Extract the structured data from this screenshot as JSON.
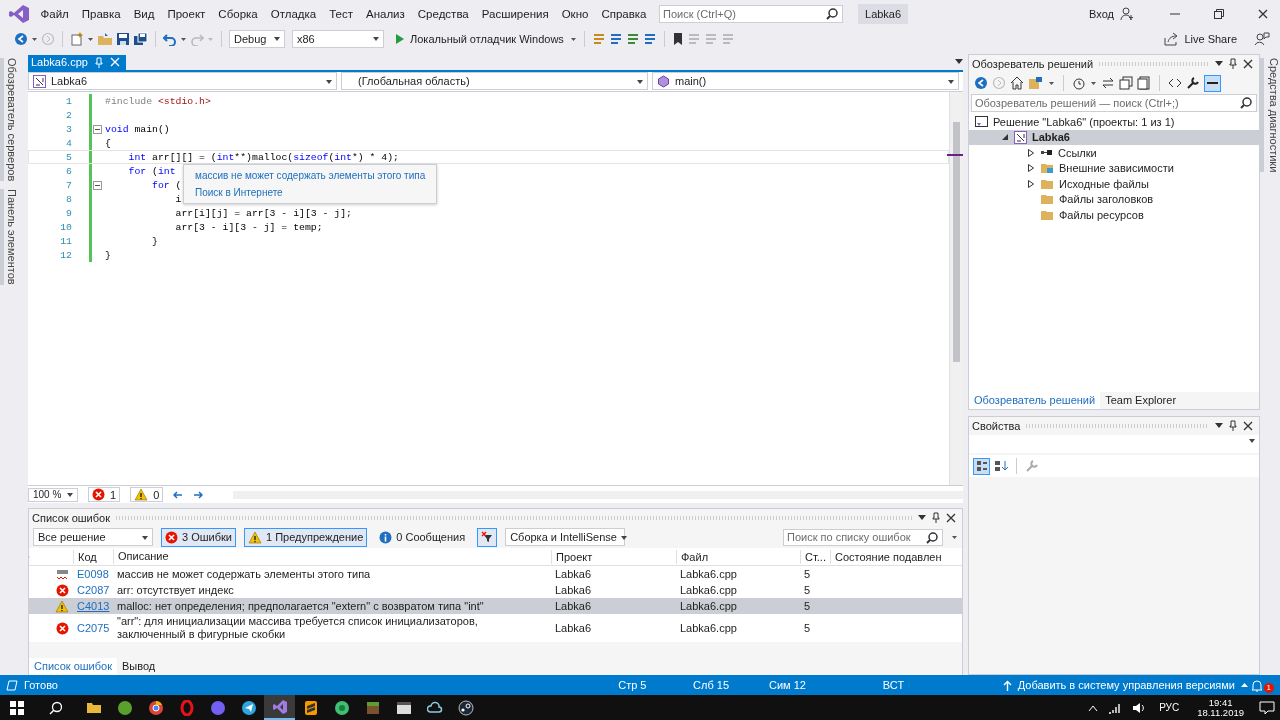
{
  "title_bar": {
    "menu": [
      "Файл",
      "Правка",
      "Вид",
      "Проект",
      "Сборка",
      "Отладка",
      "Тест",
      "Анализ",
      "Средства",
      "Расширения",
      "Окно",
      "Справка"
    ],
    "search": {
      "placeholder": "Поиск (Ctrl+Q)"
    },
    "solution_name": "Labka6",
    "sign_in": "Вход"
  },
  "toolbar": {
    "configuration": "Debug",
    "platform": "x86",
    "run": "Локальный отладчик Windows",
    "live_share": "Live Share"
  },
  "left_tabs": [
    "Обозреватель серверов",
    "Панель элементов"
  ],
  "right_tabs": [
    "Средства диагностики"
  ],
  "editor": {
    "tabs": [
      {
        "label": "Labka6.cpp",
        "selected": true
      }
    ],
    "nav": {
      "project": "Labka6",
      "scope": "(Глобальная область)",
      "member": "main()"
    },
    "lines": [
      {
        "number": "1",
        "fold": false,
        "tokens": [
          {
            "kind": "preproc",
            "text": "#include"
          },
          {
            "kind": "string",
            "text": " <stdio.h>"
          }
        ]
      },
      {
        "number": "2",
        "fold": false
      },
      {
        "number": "3",
        "fold": true,
        "tokens": [
          {
            "kind": "keyword",
            "text": "void"
          },
          {
            "kind": "text",
            "text": " main()"
          }
        ]
      },
      {
        "number": "4",
        "fold": false,
        "tokens": [
          {
            "kind": "text",
            "text": "{"
          }
        ]
      },
      {
        "number": "5",
        "fold": false,
        "tokens": [
          {
            "kind": "keyword",
            "text": "    int"
          },
          {
            "kind": "text",
            "text": " arr[][] = ("
          },
          {
            "kind": "keyword",
            "text": "int"
          },
          {
            "kind": "text",
            "text": "**)malloc("
          },
          {
            "kind": "keyword",
            "text": "sizeof"
          },
          {
            "kind": "text",
            "text": "("
          },
          {
            "kind": "keyword",
            "text": "int"
          },
          {
            "kind": "text",
            "text": "*) * 4);"
          }
        ]
      },
      {
        "number": "6",
        "fold": false,
        "tokens": [
          {
            "kind": "keyword",
            "text": "    for"
          },
          {
            "kind": "text",
            "text": " ("
          },
          {
            "kind": "keyword",
            "text": "int"
          }
        ]
      },
      {
        "number": "7",
        "fold": true,
        "tokens": [
          {
            "kind": "keyword",
            "text": "        for"
          },
          {
            "kind": "text",
            "text": " ("
          }
        ]
      },
      {
        "number": "8",
        "fold": false,
        "tokens": [
          {
            "kind": "text",
            "text": "            i"
          }
        ]
      },
      {
        "number": "9",
        "fold": false,
        "tokens": [
          {
            "kind": "text",
            "text": "            arr[i][j] = arr[3 - i][3 - j];"
          }
        ]
      },
      {
        "number": "10",
        "fold": false,
        "tokens": [
          {
            "kind": "text",
            "text": "            arr[3 - i][3 - j] = temp;"
          }
        ]
      },
      {
        "number": "11",
        "fold": false,
        "tokens": [
          {
            "kind": "text",
            "text": "        }"
          }
        ]
      },
      {
        "number": "12",
        "fold": false,
        "tokens": [
          {
            "kind": "text",
            "text": "}"
          }
        ]
      }
    ],
    "tooltip": {
      "message": "массив не может содержать элементы этого типа",
      "link": "Поиск в Интернете"
    },
    "zoom": "100 %",
    "errors": "1",
    "warnings": "0"
  },
  "error_list": {
    "title": "Список ошибок",
    "scope": "Все решение",
    "filters": [
      {
        "kind": "error",
        "label": "3 Ошибки",
        "selected": true
      },
      {
        "kind": "warning",
        "label": "1 Предупреждение",
        "selected": true
      },
      {
        "kind": "info",
        "label": "0 Сообщения",
        "selected": false
      }
    ],
    "source": "Сборка и IntelliSense",
    "search": {
      "placeholder": "Поиск по списку ошибок"
    },
    "columns": [
      "Код",
      "Описание",
      "Проект",
      "Файл",
      "Ст...",
      "Состояние подавлен"
    ],
    "rows": [
      {
        "kind": "spell",
        "code": "E0098",
        "description": "массив не может содержать элементы этого типа",
        "project": "Labka6",
        "file": "Labka6.cpp",
        "line": "5",
        "selected": false
      },
      {
        "kind": "error",
        "code": "C2087",
        "description": "arr: отсутствует индекс",
        "project": "Labka6",
        "file": "Labka6.cpp",
        "line": "5",
        "selected": false
      },
      {
        "kind": "warning",
        "code": "C4013",
        "description": "malloc: нет определения; предполагается \"extern\" с возвратом типа \"int\"",
        "project": "Labka6",
        "file": "Labka6.cpp",
        "line": "5",
        "selected": true
      },
      {
        "kind": "error",
        "code": "C2075",
        "description": "\"arr\": для инициализации массива требуется список инициализаторов, заключенный в фигурные скобки",
        "project": "Labka6",
        "file": "Labka6.cpp",
        "line": "5",
        "selected": false
      }
    ],
    "tabs": [
      {
        "label": "Список ошибок",
        "selected": true
      },
      {
        "label": "Вывод",
        "selected": false
      }
    ]
  },
  "solution_explorer": {
    "title": "Обозреватель решений",
    "search": {
      "placeholder": "Обозреватель решений — поиск (Ctrl+;)"
    },
    "tree": [
      {
        "kind": "solution",
        "label": "Решение \"Labka6\" (проекты: 1 из 1)",
        "selected": false,
        "children": [
          {
            "kind": "project",
            "label": "Labka6",
            "expanded": true,
            "selected": true,
            "children": [
              {
                "kind": "references",
                "label": "Ссылки",
                "expanded": false,
                "selected": false
              },
              {
                "kind": "external",
                "label": "Внешние зависимости",
                "expanded": false,
                "selected": false
              },
              {
                "kind": "folder",
                "label": "Исходные файлы",
                "expanded": false,
                "selected": false
              },
              {
                "kind": "folder",
                "label": "Файлы заголовков",
                "selected": false
              },
              {
                "kind": "folder",
                "label": "Файлы ресурсов",
                "selected": false
              }
            ]
          }
        ]
      }
    ],
    "tabs": [
      {
        "label": "Обозреватель решений",
        "selected": true
      },
      {
        "label": "Team Explorer",
        "selected": false
      }
    ]
  },
  "properties": {
    "title": "Свойства"
  },
  "status_bar": {
    "state": "Готово",
    "line": "Стр 5",
    "column": "Слб 15",
    "char": "Сим 12",
    "mode": "ВСТ",
    "source_control": "Добавить в систему управления версиями",
    "notifications": "1"
  },
  "taskbar": {
    "language": "РУС",
    "time": "19:41",
    "date": "18.11.2019"
  }
}
